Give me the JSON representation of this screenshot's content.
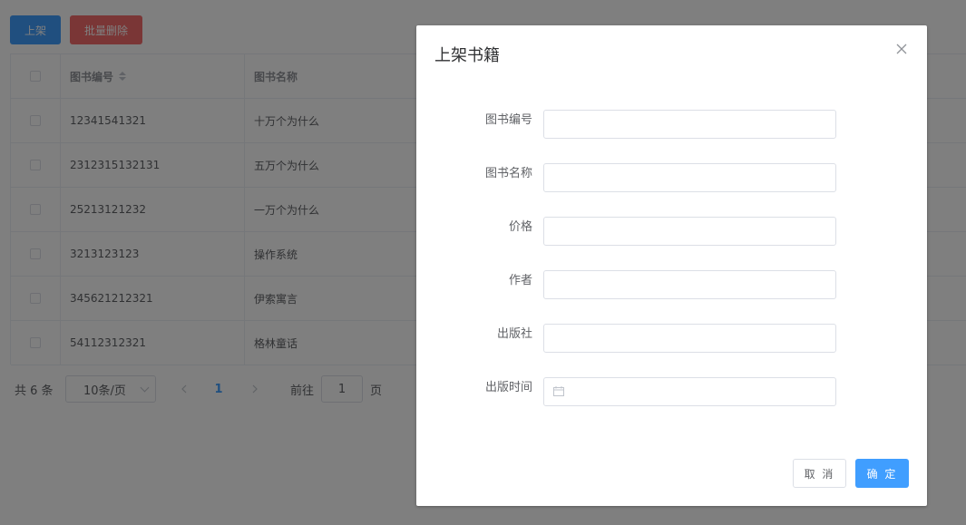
{
  "toolbar": {
    "add_label": "上架",
    "batch_delete_label": "批量删除"
  },
  "table": {
    "headers": {
      "id": "图书编号",
      "name": "图书名称"
    },
    "rows": [
      {
        "id": "12341541321",
        "name": "十万个为什么"
      },
      {
        "id": "2312315132131",
        "name": "五万个为什么"
      },
      {
        "id": "25213121232",
        "name": "一万个为什么"
      },
      {
        "id": "3213123123",
        "name": "操作系统"
      },
      {
        "id": "345621212321",
        "name": "伊索寓言"
      },
      {
        "id": "54112312321",
        "name": "格林童话"
      }
    ]
  },
  "pagination": {
    "total": "共 6 条",
    "page_size": "10条/页",
    "current_page": "1",
    "goto_label": "前往",
    "goto_value": "1",
    "page_unit": "页"
  },
  "dialog": {
    "title": "上架书籍",
    "fields": {
      "book_id": {
        "label": "图书编号",
        "value": ""
      },
      "book_name": {
        "label": "图书名称",
        "value": ""
      },
      "price": {
        "label": "价格",
        "value": ""
      },
      "author": {
        "label": "作者",
        "value": ""
      },
      "publisher": {
        "label": "出版社",
        "value": ""
      },
      "publish_date": {
        "label": "出版时间",
        "value": ""
      }
    },
    "cancel_label": "取 消",
    "confirm_label": "确 定"
  },
  "colors": {
    "primary": "#409eff",
    "danger": "#f56c6c",
    "overlay": "rgba(0,0,0,0.5)"
  }
}
